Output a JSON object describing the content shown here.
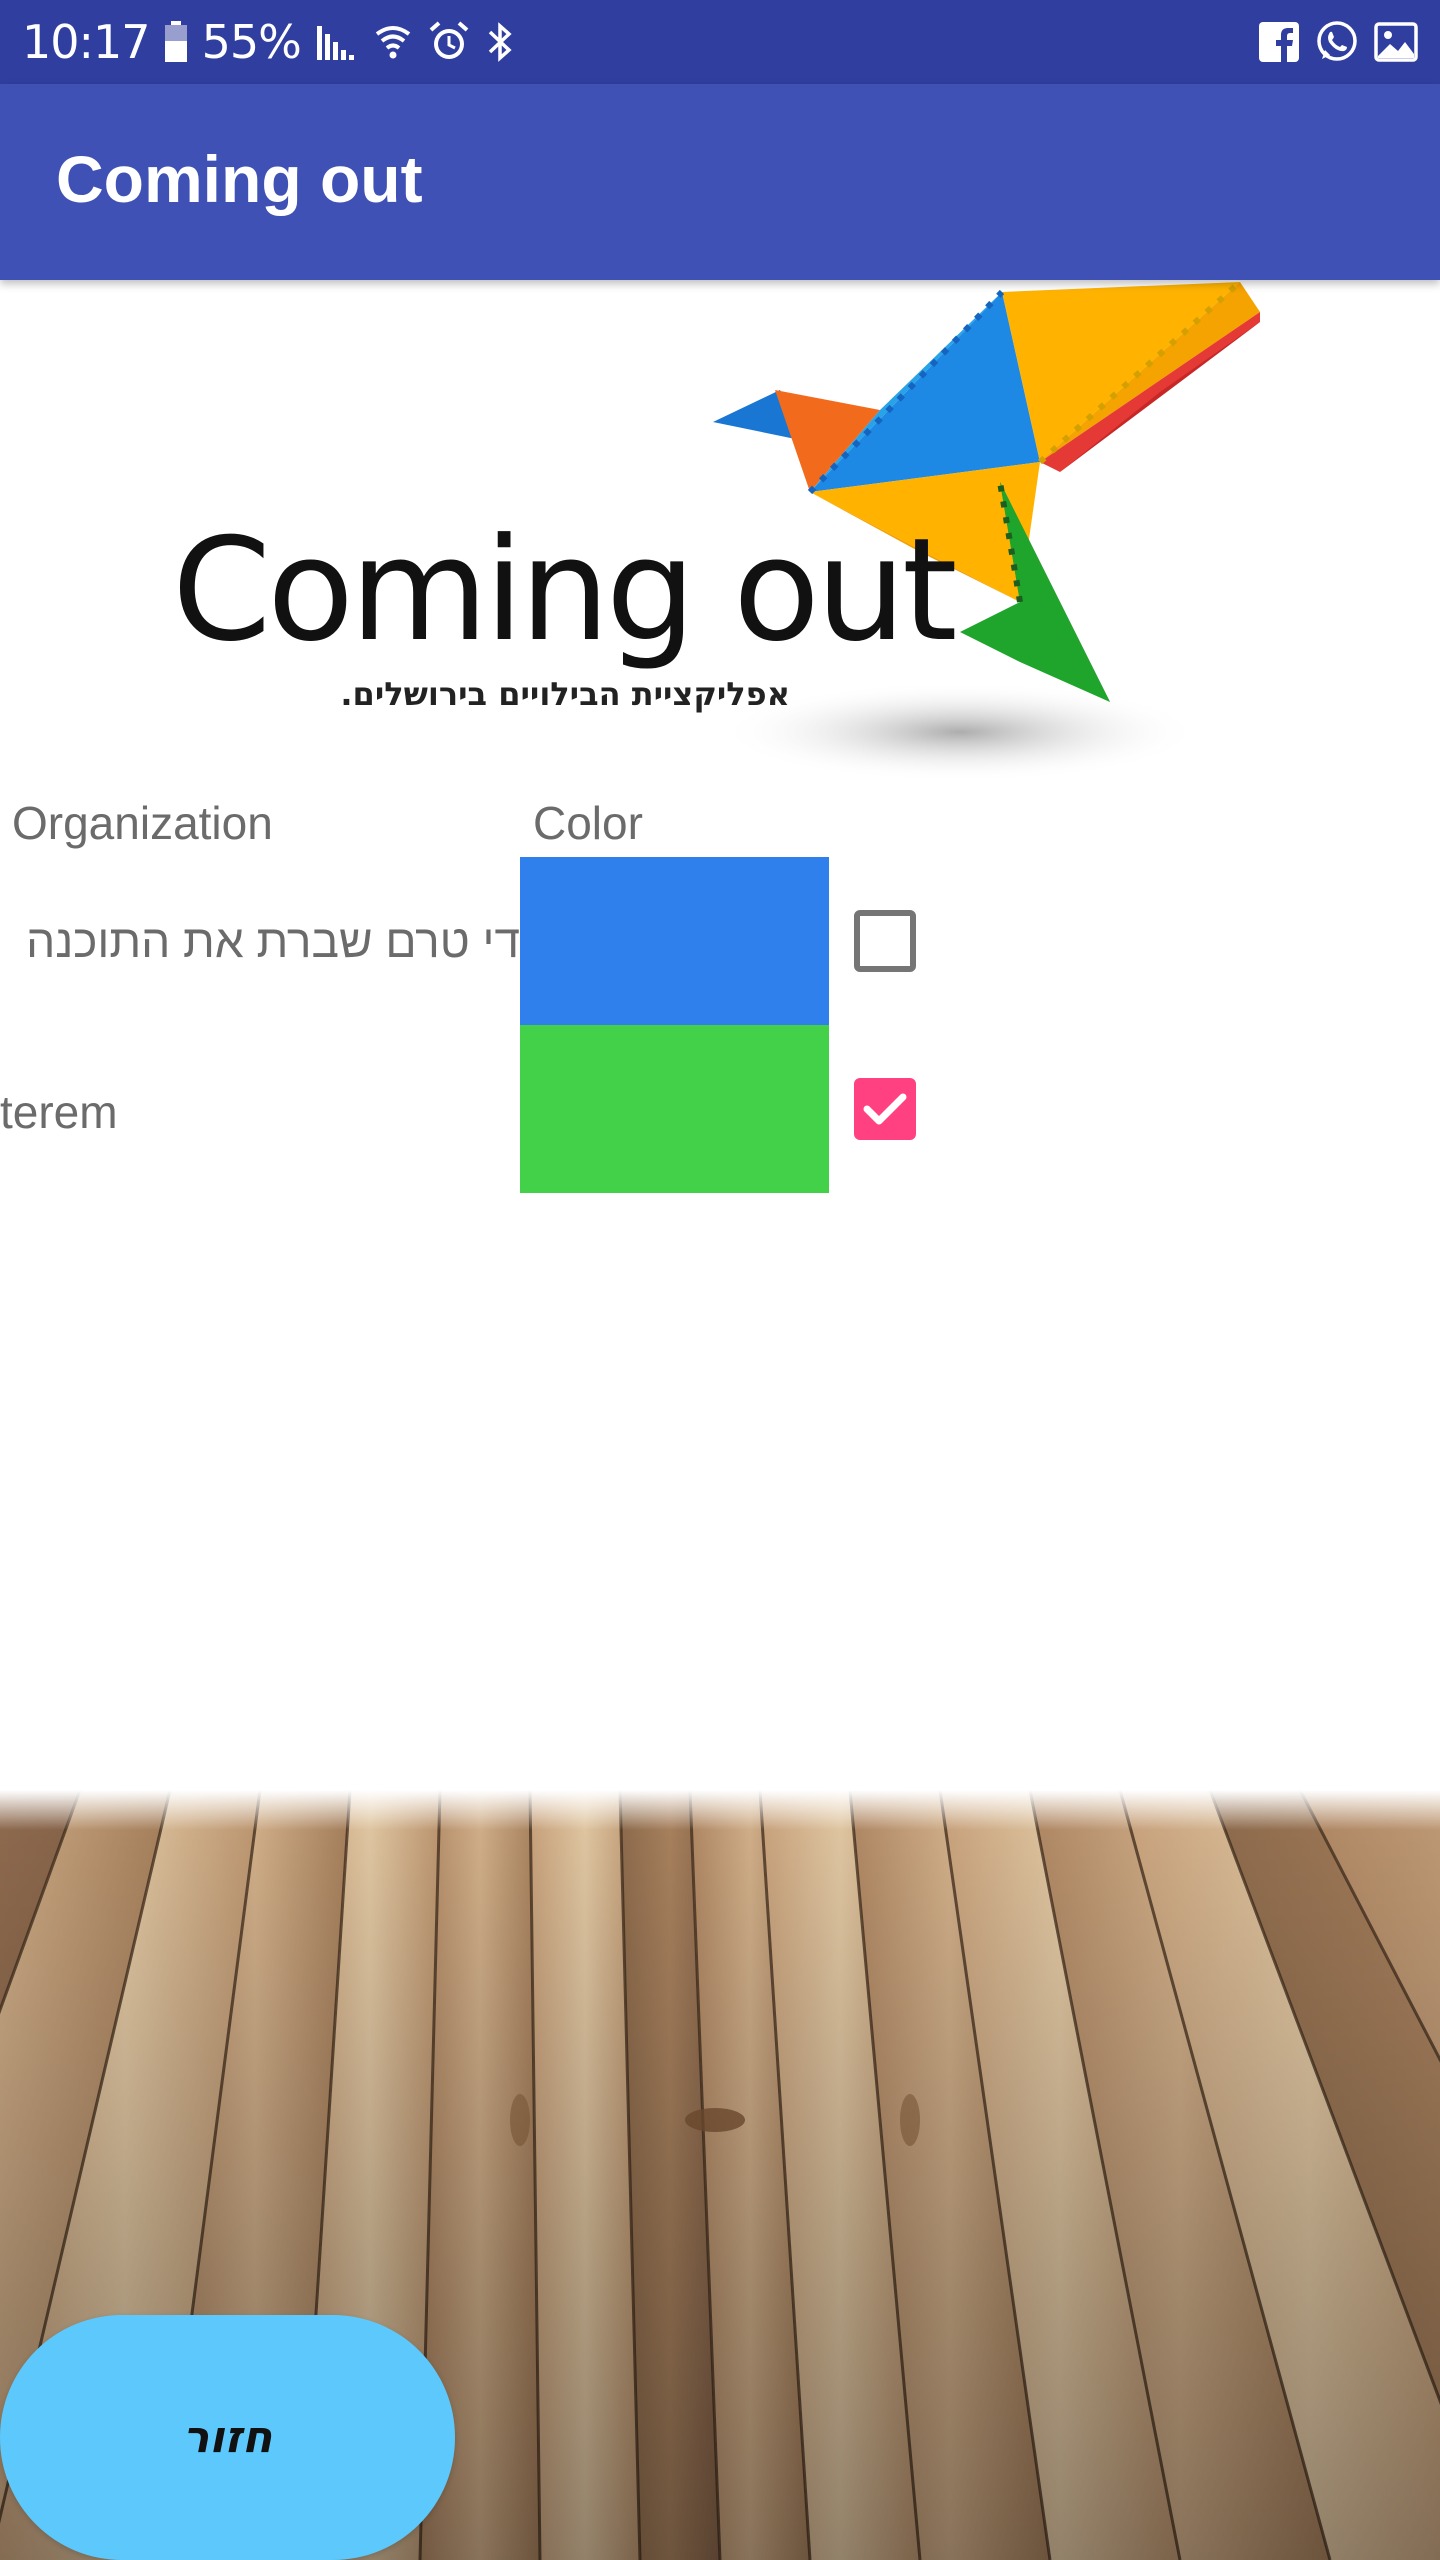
{
  "status_bar": {
    "time": "10:17",
    "battery": "55%",
    "icons_left": [
      "battery-icon",
      "signal-icon",
      "wifi-icon",
      "alarm-icon",
      "bluetooth-icon"
    ],
    "icons_right": [
      "facebook-icon",
      "whatsapp-icon",
      "image-icon"
    ],
    "background": "#303F9F"
  },
  "app_bar": {
    "title": "Coming out",
    "background": "#3F51B5"
  },
  "logo": {
    "wordmark": "Coming out",
    "tagline": "אפליקציית הבילויים בירושלים."
  },
  "table": {
    "headers": {
      "organization": "Organization",
      "color": "Color"
    },
    "rows": [
      {
        "organization": "די טרם שברת את התוכנה",
        "color": "#2F80ED",
        "checked": false
      },
      {
        "organization": "terem",
        "color": "#43D14A",
        "checked": true
      }
    ],
    "checkbox_accent": "#FF4081"
  },
  "back_button": {
    "label": "חזור",
    "background": "#5DC8FC"
  }
}
